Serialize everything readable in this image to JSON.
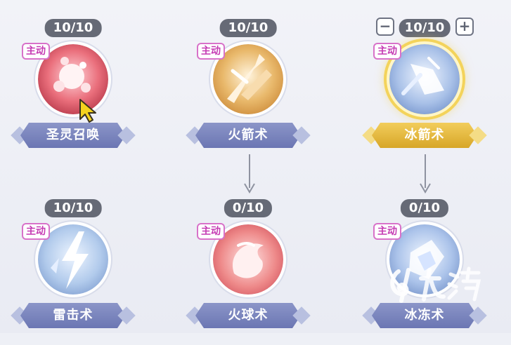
{
  "skills": [
    {
      "level": "10/10",
      "tag": "主动",
      "name": "圣灵召唤",
      "orb": "holy-summon",
      "highlight": false
    },
    {
      "level": "10/10",
      "tag": "主动",
      "name": "火箭术",
      "orb": "fire-arrow",
      "highlight": false
    },
    {
      "level": "10/10",
      "tag": "主动",
      "name": "冰箭术",
      "orb": "ice-arrow",
      "highlight": true
    },
    {
      "level": "10/10",
      "tag": "主动",
      "name": "雷击术",
      "orb": "lightning",
      "highlight": false
    },
    {
      "level": "0/10",
      "tag": "主动",
      "name": "火球术",
      "orb": "fireball",
      "highlight": false
    },
    {
      "level": "0/10",
      "tag": "主动",
      "name": "冰冻术",
      "orb": "freeze",
      "highlight": false
    }
  ],
  "stepper": {
    "minus": "−",
    "plus": "+"
  },
  "watermark": {
    "text": "九游"
  },
  "colors": {
    "level_bg": "#666a76",
    "name_bar": "#6b76b3",
    "name_bar_selected": "#d7a628",
    "tag_border": "#d872c9"
  }
}
